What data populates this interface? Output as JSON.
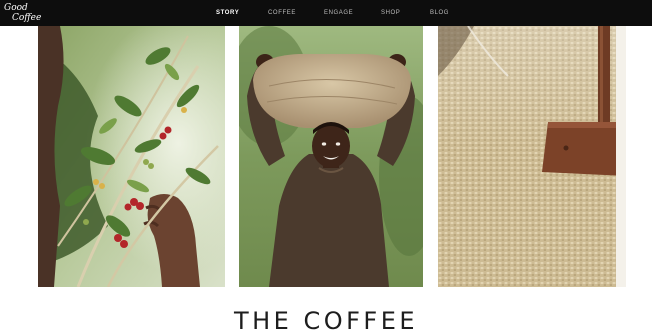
{
  "logo": {
    "line1": "Good",
    "line2": "Coffee"
  },
  "nav": {
    "items": [
      {
        "label": "STORY",
        "active": true
      },
      {
        "label": "COFFEE",
        "active": false
      },
      {
        "label": "ENGAGE",
        "active": false
      },
      {
        "label": "SHOP",
        "active": false
      },
      {
        "label": "BLOG",
        "active": false
      }
    ]
  },
  "section": {
    "title": "THE COFFEE"
  },
  "colors": {
    "navbar_bg": "#0d0d0d",
    "nav_active": "#ffffff",
    "nav_inactive": "#bdbdbd",
    "heading": "#1d1d1d"
  }
}
